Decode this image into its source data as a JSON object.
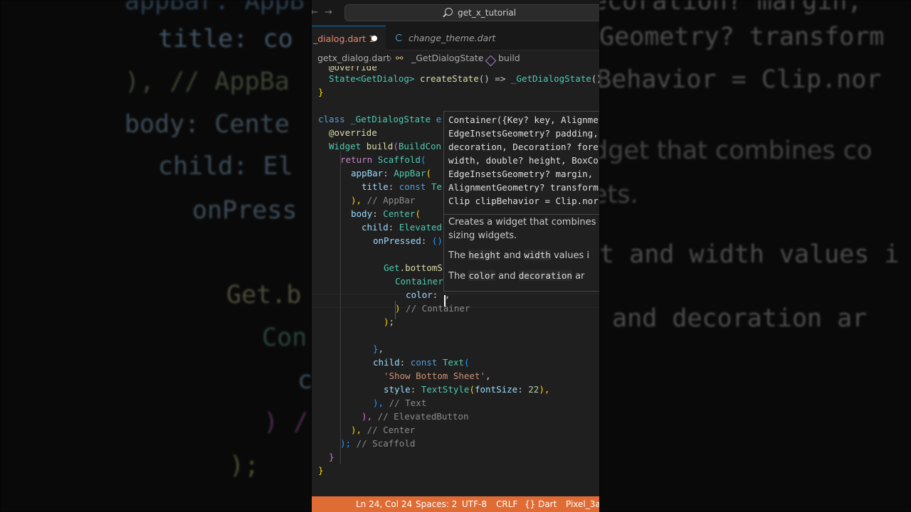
{
  "titlebar": {
    "back_icon": "arrow-left-icon",
    "forward_icon": "arrow-right-icon",
    "search_text": "get_x_tutorial"
  },
  "tabs": [
    {
      "label": "_dialog.dart 1",
      "dirty": true
    },
    {
      "label": "change_theme.dart"
    }
  ],
  "breadcrumb": {
    "file": "getx_dialog.dart",
    "class": "_GetDialogState",
    "method": "build"
  },
  "code": {
    "override_partial": "@override",
    "create_state": [
      "State<GetDialog> ",
      "createState",
      "() => ",
      "_GetDialogState",
      "();"
    ],
    "class_line": [
      "class ",
      "_GetDialogState",
      " e"
    ],
    "override": "@override",
    "build_line": [
      "Widget ",
      "build",
      "(",
      "BuildCon"
    ],
    "return_line": [
      "return ",
      "Scaffold",
      "("
    ],
    "appbar_line": [
      "appBar",
      ": ",
      "AppBar",
      "("
    ],
    "title_line": [
      "title",
      ": ",
      "const ",
      "Te"
    ],
    "appbar_close": [
      "), ",
      "// AppBar"
    ],
    "body_line": [
      "body",
      ": ",
      "Center",
      "("
    ],
    "child_line": [
      "child",
      ": ",
      "Elevated"
    ],
    "onpressed_line": [
      "onPressed",
      ": ",
      "()"
    ],
    "getbottom_line": [
      "Get",
      ".",
      "bottomS"
    ],
    "container_line": [
      "Container"
    ],
    "color_line": [
      "color",
      ": ",
      ","
    ],
    "container_close": [
      ")",
      " // Container"
    ],
    "semicolon": [
      ")",
      ";"
    ],
    "brace_comma": [
      "}",
      ","
    ],
    "child_text_line": [
      "child",
      ": ",
      "const ",
      "Text",
      "("
    ],
    "string_line": [
      "'Show Bottom Sheet'",
      ","
    ],
    "style_line": [
      "style",
      ": ",
      "TextStyle",
      "(",
      "fontSize",
      ": ",
      "22",
      "),"
    ],
    "text_close": [
      "), ",
      "// Text"
    ],
    "eb_close": [
      "), ",
      "// ElevatedButton"
    ],
    "center_close": [
      "), ",
      "// Center"
    ],
    "scaffold_close": [
      ");",
      " // Scaffold"
    ],
    "close_brace": "}",
    "final_brace": "}"
  },
  "hover": {
    "signature": [
      "Container({Key? key, Alignme",
      "EdgeInsetsGeometry? padding,",
      "decoration, Decoration? fore",
      "width, double? height, BoxCo",
      "EdgeInsetsGeometry? margin,",
      "AlignmentGeometry? transform",
      "Clip clipBehavior = Clip.nor"
    ],
    "doc1": "Creates a widget that combines co",
    "doc2": "sizing widgets.",
    "doc3": [
      "The ",
      "height",
      " and ",
      "width",
      " values i"
    ],
    "doc4": [
      "The ",
      "color",
      " and ",
      "decoration",
      " ar"
    ]
  },
  "status": {
    "position": "Ln 24, Col 24",
    "spaces": "Spaces: 2",
    "encoding": "UTF-8",
    "eol": "CRLF",
    "language": "{} Dart",
    "device": "Pixel_3a_"
  },
  "background": {
    "left": [
      "appBar: AppB",
      "title: co",
      "), // AppBa",
      "body: Cente",
      "child: El",
      "onPress",
      "Get.b",
      "Con",
      "c",
      ") /",
      ");"
    ],
    "right": [
      "ecoration? margin,",
      "Geometry? transform",
      "Behavior = Clip.nor",
      "dget that combines co",
      "ets.",
      "t and width values i",
      "and decoration ar"
    ]
  },
  "colors": {
    "status_bar": "#e06c35",
    "editor_bg": "#1f1f1f",
    "accent": "#0078d4"
  }
}
